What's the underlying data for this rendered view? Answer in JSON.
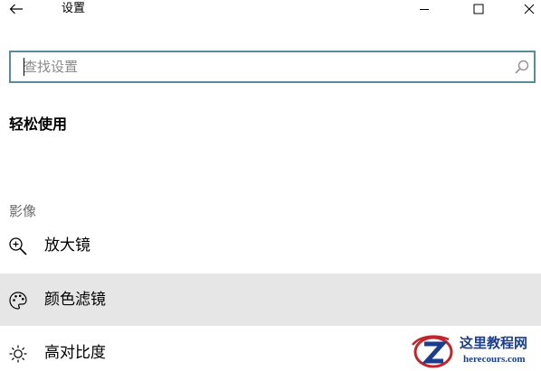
{
  "window": {
    "title": "设置",
    "controls": {
      "back_icon": "arrow-left-icon",
      "minimize_icon": "minimize-icon",
      "maximize_icon": "maximize-icon",
      "close_icon": "close-icon"
    }
  },
  "search": {
    "placeholder": "查找设置",
    "value": "",
    "icon": "search-icon",
    "border_color": "#5b8a98"
  },
  "page": {
    "title": "轻松使用"
  },
  "groups": [
    {
      "label": "影像",
      "items": [
        {
          "label": "放大镜",
          "icon": "magnifier-plus-icon",
          "selected": false
        },
        {
          "label": "颜色滤镜",
          "icon": "palette-icon",
          "selected": true
        },
        {
          "label": "高对比度",
          "icon": "brightness-icon",
          "selected": false
        }
      ]
    }
  ],
  "colors": {
    "selected_background": "#e6e6e6",
    "group_label": "#6b6b6b"
  },
  "watermark": {
    "text_cn": "这里教程网",
    "text_en": "herecours.com",
    "color": "#1a3e8c"
  }
}
